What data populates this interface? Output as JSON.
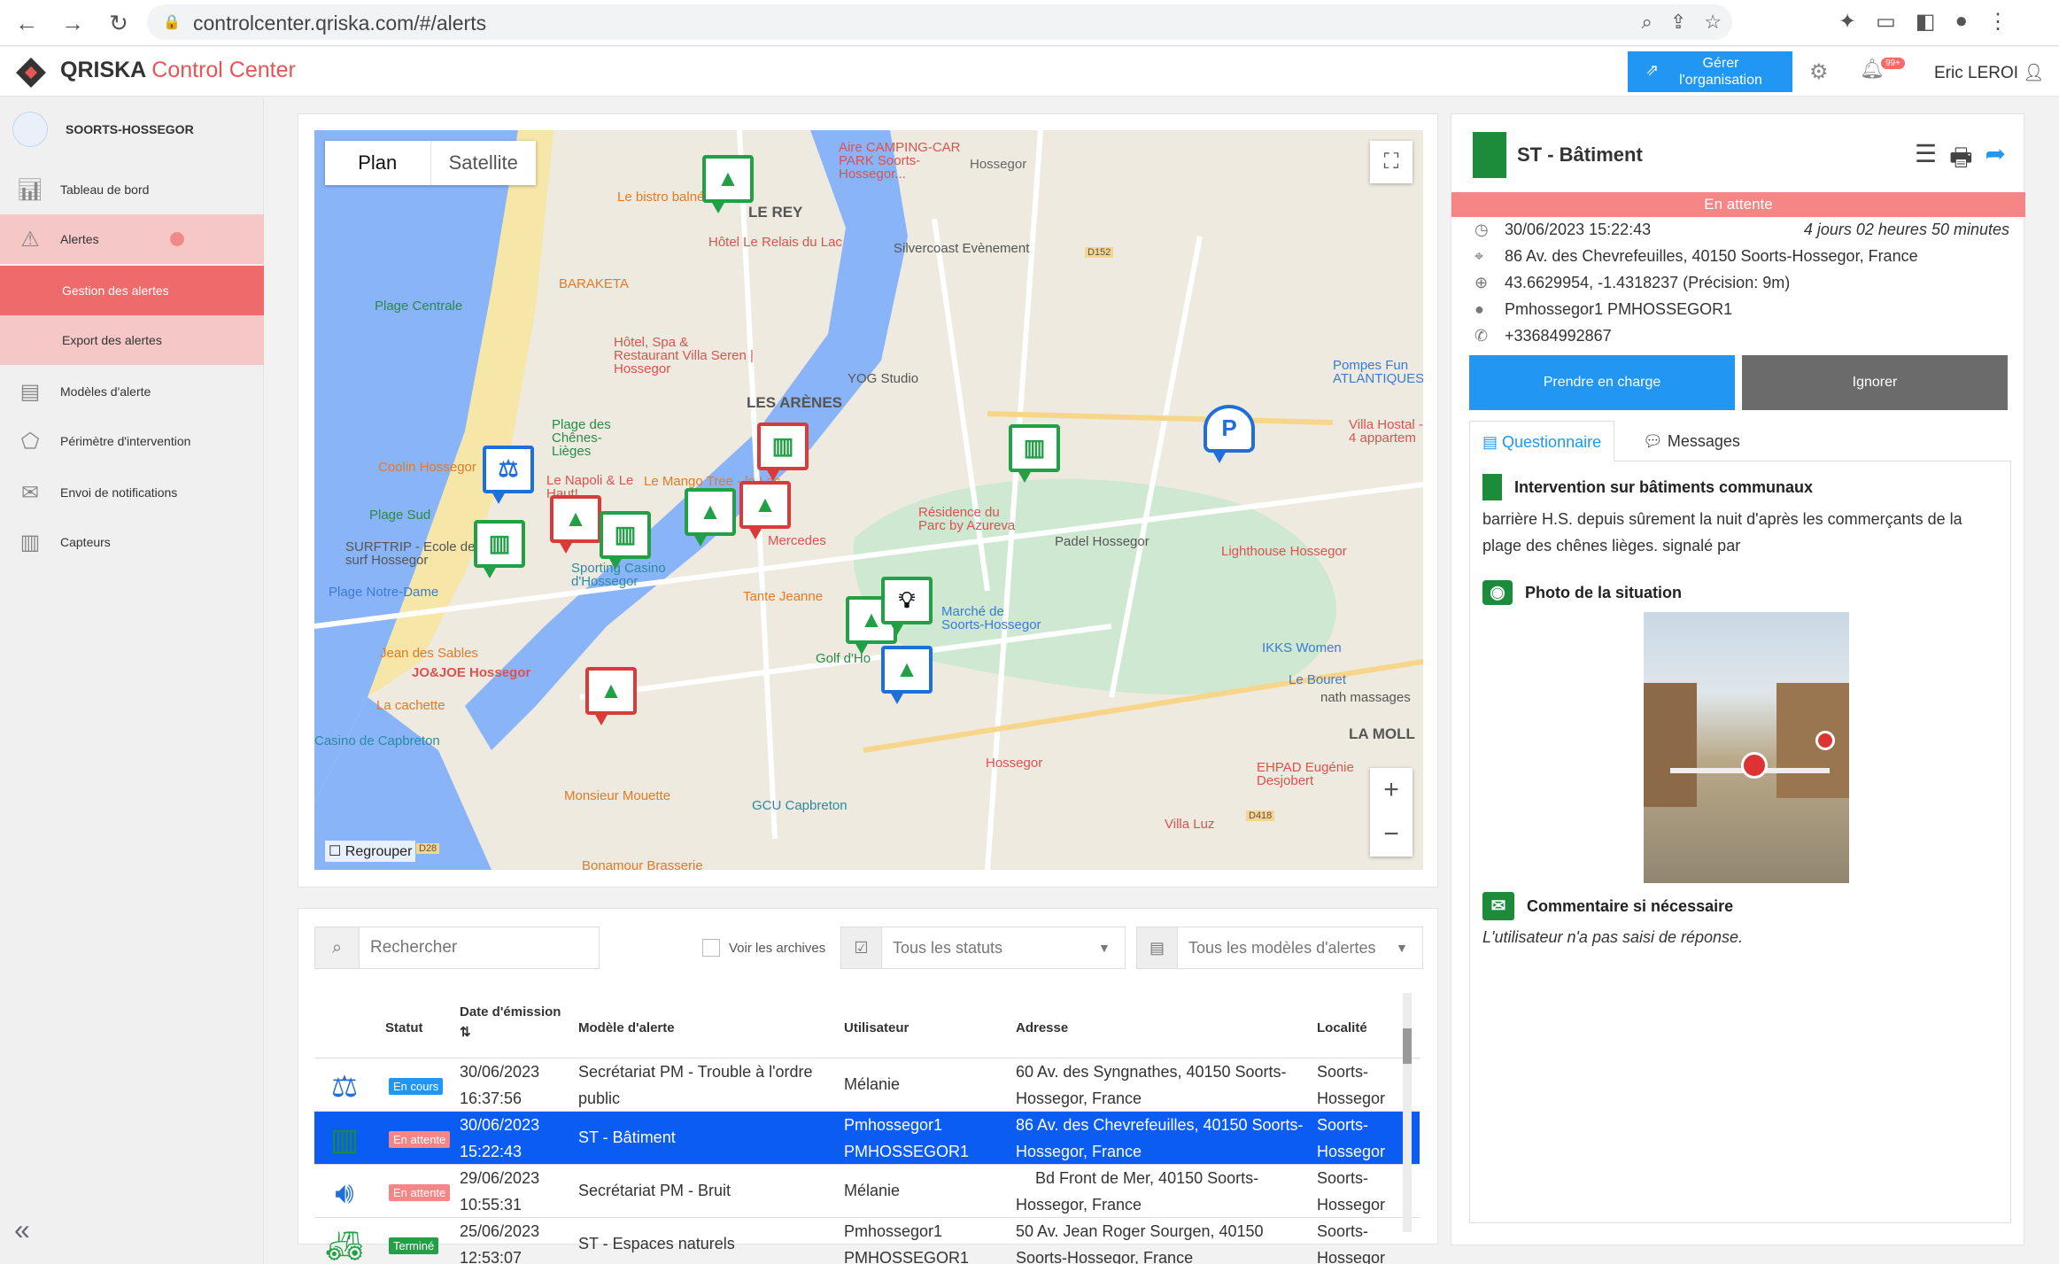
{
  "browser": {
    "url": "controlcenter.qriska.com/#/alerts"
  },
  "header": {
    "brand_main": "QRISKA",
    "brand_accent": "Control Center",
    "manage_label_1": "Gérer",
    "manage_label_2": "l'organisation",
    "notif_badge": "99+",
    "user": "Eric LEROI"
  },
  "sidebar": {
    "org": "SOORTS-HOSSEGOR",
    "items": [
      {
        "label": "Tableau de bord",
        "icon": "chart-icon"
      },
      {
        "label": "Alertes",
        "icon": "warning-icon"
      },
      {
        "label": "Gestion des alertes"
      },
      {
        "label": "Export des alertes"
      },
      {
        "label": "Modèles d'alerte",
        "icon": "document-icon"
      },
      {
        "label": "Périmètre d'intervention",
        "icon": "polygon-icon"
      },
      {
        "label": "Envoi de notifications",
        "icon": "envelope-icon"
      },
      {
        "label": "Capteurs",
        "icon": "sensor-icon"
      }
    ]
  },
  "map": {
    "tab_plan": "Plan",
    "tab_satellite": "Satellite",
    "regroup": "Regrouper",
    "labels": {
      "camping": "Aire CAMPING-CAR PARK Soorts-Hossegor...",
      "bistro": "Le bistro balnéaire",
      "hossegor": "Hossegor",
      "le_rey": "LE REY",
      "relais": "Hôtel Le Relais du Lac",
      "silvercoast": "Silvercoast Evènement",
      "baraketa": "BARAKETA",
      "plage_centrale": "Plage Centrale",
      "hotel_spa": "Hôtel, Spa & Restaurant Villa Seren | Hossegor",
      "les_arenes": "LES ARÈNES",
      "yog": "YOG Studio",
      "pompes": "Pompes Fun ATLANTIQUES",
      "plage_chenes": "Plage des Chênes-Lièges",
      "villa_hostal": "Villa Hostal - 4 appartem",
      "coolin": "Coolin Hossegor",
      "napoli": "Le Napoli & Le Haut!",
      "mango": "Le Mango Tree - le Lac",
      "residence": "Résidence du Parc by Azureva",
      "padel": "Padel Hossegor",
      "plage_sud": "Plage Sud",
      "surftrip": "SURFTRIP - Ecole de surf Hossegor",
      "mercedes": "Mercedes",
      "sporting": "Sporting Casino d'Hossegor",
      "lighthouse": "Lighthouse Hossegor",
      "plage_nd": "Plage Notre-Dame",
      "tante_jeanne": "Tante Jeanne",
      "marche": "Marché de Soorts-Hossegor",
      "jean_sables": "Jean des Sables",
      "jojoe": "JO&JOE Hossegor",
      "golf": "Golf d'Ho",
      "ikks": "IKKS Women",
      "le_bouret": "Le Bouret",
      "nath": "nath massages",
      "la_cachette": "La cachette",
      "casino_capbreton": "Casino de Capbreton",
      "la_molle": "LA MOLL",
      "hossegor2": "Hossegor",
      "ehpad": "EHPAD Eugénie Desjobert",
      "monsieur_mouette": "Monsieur Mouette",
      "gcu": "GCU Capbreton",
      "villa_luz": "Villa Luz",
      "bonamour": "Bonamour Brasserie",
      "road_d152": "D152",
      "road_d28": "D28",
      "road_d418": "D418"
    }
  },
  "table": {
    "search_placeholder": "Rechercher",
    "archives": "Voir les archives",
    "status_filter": "Tous les statuts",
    "model_filter": "Tous les modèles d'alertes",
    "headers": {
      "status": "Statut",
      "date": "Date d'émission",
      "model": "Modèle d'alerte",
      "user": "Utilisateur",
      "address": "Adresse",
      "locality": "Localité"
    },
    "rows": [
      {
        "status": "En cours",
        "date1": "30/06/2023",
        "date2": "16:37:56",
        "model1": "Secrétariat PM - Trouble à l'ordre",
        "model2": "public",
        "user1": "Mélanie",
        "user2": "",
        "addr1": "60 Av. des Syngnathes, 40150 Soorts-",
        "addr2": "Hossegor, France",
        "loc1": "Soorts-",
        "loc2": "Hossegor"
      },
      {
        "status": "En attente",
        "date1": "30/06/2023",
        "date2": "15:22:43",
        "model1": "ST - Bâtiment",
        "model2": "",
        "user1": "Pmhossegor1",
        "user2": "PMHOSSEGOR1",
        "addr1": "86 Av. des Chevrefeuilles, 40150 Soorts-",
        "addr2": "Hossegor, France",
        "loc1": "Soorts-",
        "loc2": "Hossegor"
      },
      {
        "status": "En attente",
        "date1": "29/06/2023",
        "date2": "10:55:31",
        "model1": "Secrétariat PM - Bruit",
        "model2": "",
        "user1": "Mélanie",
        "user2": "",
        "addr1": "Bd Front de Mer, 40150 Soorts-",
        "addr2": "Hossegor, France",
        "loc1": "Soorts-",
        "loc2": "Hossegor"
      },
      {
        "status": "Terminé",
        "date1": "25/06/2023",
        "date2": "12:53:07",
        "model1": "ST - Espaces naturels",
        "model2": "",
        "user1": "Pmhossegor1",
        "user2": "PMHOSSEGOR1",
        "addr1": "50 Av. Jean Roger Sourgen, 40150",
        "addr2": "Soorts-Hossegor, France",
        "loc1": "Soorts-",
        "loc2": "Hossegor"
      }
    ]
  },
  "detail": {
    "title": "ST - Bâtiment",
    "status": "En attente",
    "datetime": "30/06/2023 15:22:43",
    "elapsed": "4 jours 02 heures 50 minutes",
    "address": "86 Av. des Chevrefeuilles, 40150 Soorts-Hossegor, France",
    "coords": "43.6629954, -1.4318237 (Précision: 9m)",
    "user": "Pmhossegor1 PMHOSSEGOR1",
    "phone": "+33684992867",
    "take_btn": "Prendre en charge",
    "ignore_btn": "Ignorer",
    "tab_questionnaire": "Questionnaire",
    "tab_messages": "Messages",
    "section1_title": "Intervention sur bâtiments communaux",
    "section1_text": "barrière H.S. depuis sûrement la nuit d'après les commerçants de la plage des chênes lièges. signalé par",
    "section2_title": "Photo de la situation",
    "section3_title": "Commentaire si nécessaire",
    "section3_text": "L'utilisateur n'a pas saisi de réponse."
  },
  "colors": {
    "accent_red": "#ef6b6b",
    "primary_blue": "#2196f3",
    "selected_row": "#0b5cf3",
    "green": "#22a045"
  }
}
